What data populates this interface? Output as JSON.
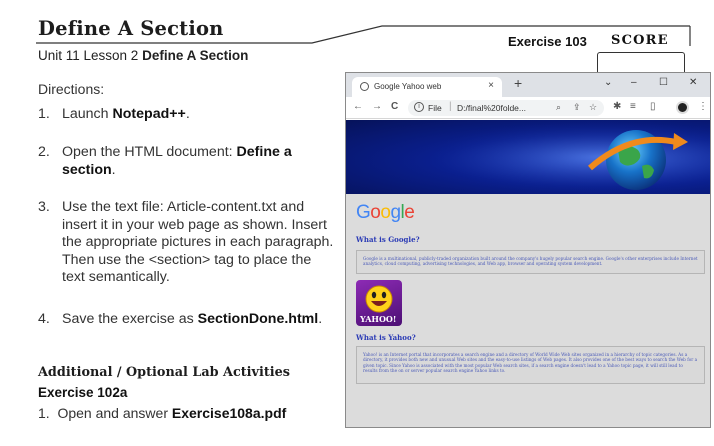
{
  "header": {
    "title": "Define A Section",
    "subtitle_prefix": "Unit 11 Lesson 2",
    "subtitle_bold": "Define A Section",
    "exercise": "Exercise 103",
    "score": "SCORE"
  },
  "directions": {
    "heading": "Directions:",
    "steps": [
      {
        "num": "1.",
        "text": "Launch ",
        "bold": "Notepad++",
        "after": "."
      },
      {
        "num": "2.",
        "text": "Open the HTML document: ",
        "bold": "Define a section",
        "after": "."
      },
      {
        "num": "3.",
        "text": "Use the text file: Article-content.txt and insert it in your web page as shown. Insert the appropriate pictures in each paragraph. Then use the <section> tag to place the text semantically.",
        "bold": "",
        "after": ""
      },
      {
        "num": "4.",
        "text": "Save the exercise as ",
        "bold": "SectionDone.html",
        "after": "."
      }
    ]
  },
  "additional": {
    "heading": "Additional / Optional Lab Activities",
    "exercise": "Exercise 102a",
    "step_num": "1.",
    "step_text": "Open and answer ",
    "step_bold": "Exercise108a.pdf"
  },
  "browser": {
    "tab_title": "Google Yahoo web",
    "tab_close": "×",
    "new_tab": "+",
    "window_controls": [
      "⌄",
      "–",
      "☐",
      "✕"
    ],
    "nav": [
      "←",
      "→",
      "C"
    ],
    "address_info": "i",
    "address_file": "File",
    "address_url": "D:/final%20folde...",
    "toolbar_icons": [
      "zoom-icon",
      "share-icon",
      "star-icon",
      "extensions-icon",
      "reading-list-icon",
      "side-panel-icon",
      "profile-icon",
      "menu-icon"
    ]
  },
  "page": {
    "google_logo_letters": [
      {
        "ch": "G",
        "color": "#4285f4"
      },
      {
        "ch": "o",
        "color": "#ea4335"
      },
      {
        "ch": "o",
        "color": "#fbbc05"
      },
      {
        "ch": "g",
        "color": "#4285f4"
      },
      {
        "ch": "l",
        "color": "#34a853"
      },
      {
        "ch": "e",
        "color": "#ea4335"
      }
    ],
    "google_heading": "What is Google?",
    "google_text": "Google is a multinational, publicly-traded organization built around the company's hugely popular search engine. Google's other enterprises include Internet analytics, cloud computing, advertising technologies, and Web app, browser and operating system development.",
    "yahoo_logo_text": "YAHOO!",
    "yahoo_heading": "What is Yahoo?",
    "yahoo_text": "Yahoo! is an Internet portal that incorporates a search engine and a directory of World Wide Web sites organized in a hierarchy of topic categories. As a directory, it provides both new and unusual Web sites and the easy-to-use listings of Web pages. It also provides one of the best ways to search the Web for a given topic. Since Yahoo is associated with the most popular Web search sites, if a search engine doesn't lead to a Yahoo topic page, it will still lead to results from the on or server popular search engine Yahoo links to."
  }
}
